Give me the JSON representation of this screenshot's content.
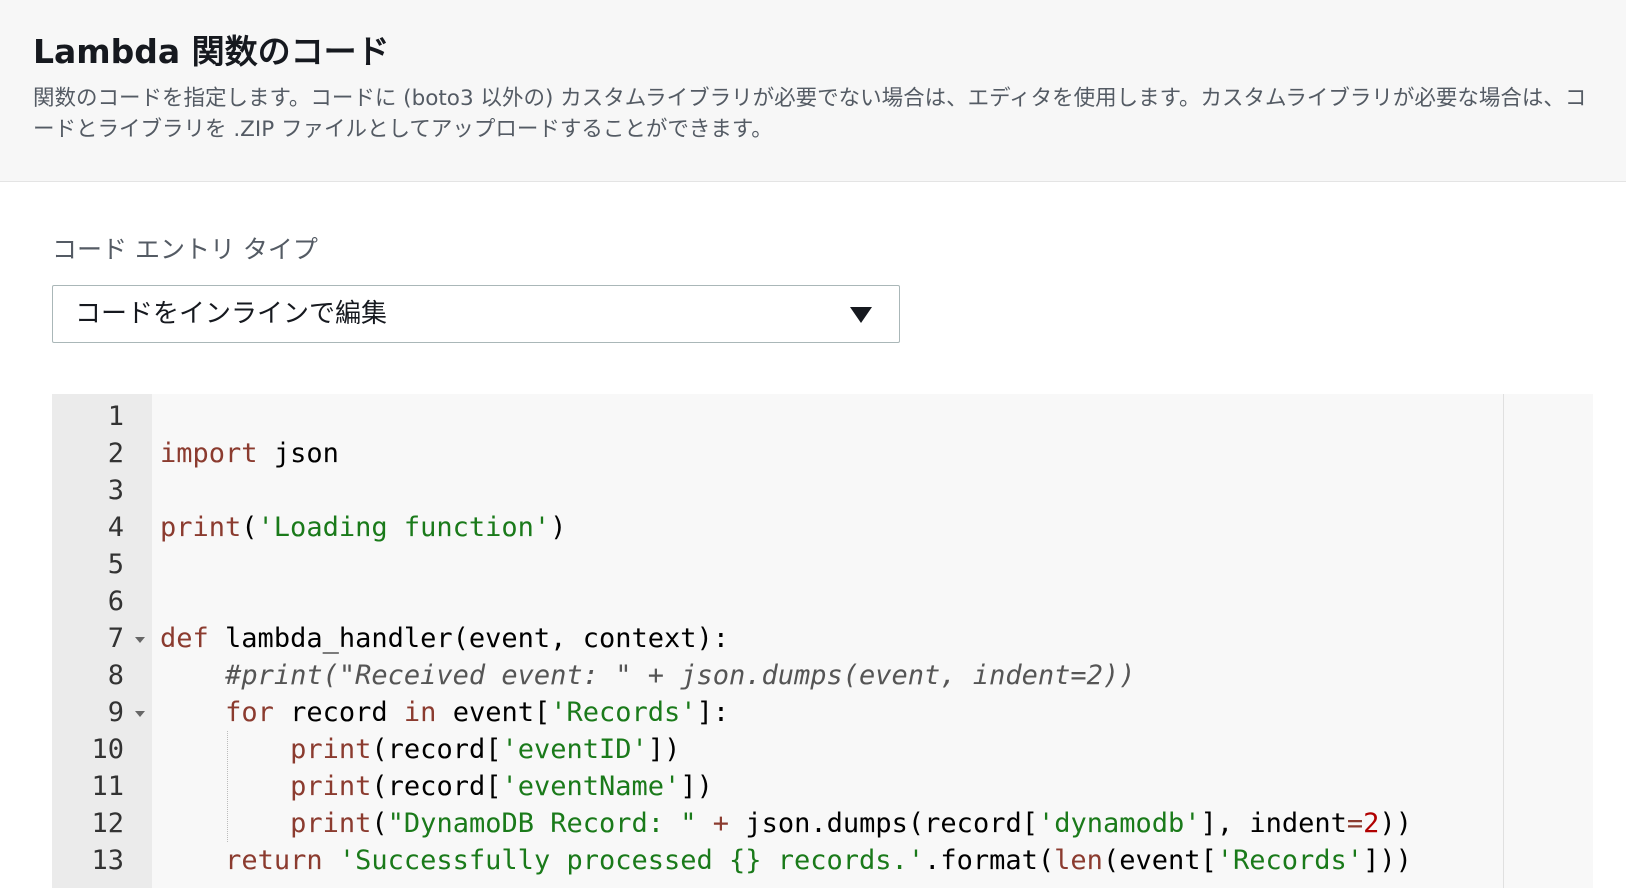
{
  "header": {
    "title": "Lambda 関数のコード",
    "description": "関数のコードを指定します。コードに (boto3 以外の) カスタムライブラリが必要でない場合は、エディタを使用します。カスタムライブラリが必要な場合は、コードとライブラリを .ZIP ファイルとしてアップロードすることができます。"
  },
  "code_entry": {
    "label": "コード エントリ タイプ",
    "selected": "コードをインラインで編集"
  },
  "editor": {
    "line_numbers": [
      "1",
      "2",
      "3",
      "4",
      "5",
      "6",
      "7",
      "8",
      "9",
      "10",
      "11",
      "12",
      "13"
    ],
    "folded_lines": [
      7,
      9
    ],
    "lines": [
      "",
      "import json",
      "",
      "print('Loading function')",
      "",
      "",
      "def lambda_handler(event, context):",
      "    #print(\"Received event: \" + json.dumps(event, indent=2))",
      "    for record in event['Records']:",
      "        print(record['eventID'])",
      "        print(record['eventName'])",
      "        print(\"DynamoDB Record: \" + json.dumps(record['dynamodb'], indent=2))",
      "    return 'Successfully processed {} records.'.format(len(event['Records']))"
    ]
  }
}
